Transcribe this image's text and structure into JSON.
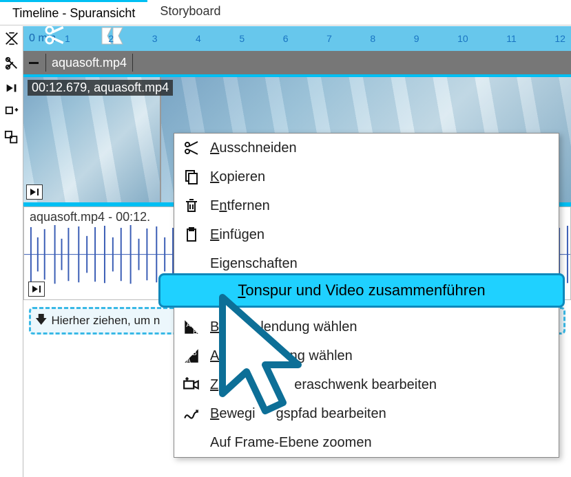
{
  "tabs": {
    "timeline": "Timeline - Spuransicht",
    "storyboard": "Storyboard"
  },
  "ruler": {
    "firstlabel": "0 min",
    "ticks": [
      "1",
      "2",
      "3",
      "4",
      "5",
      "6",
      "7",
      "8",
      "9",
      "10",
      "11",
      "12"
    ]
  },
  "trackheader": {
    "filename": "aquasoft.mp4"
  },
  "video": {
    "label": "00:12.679,  aquasoft.mp4"
  },
  "audio": {
    "label": "aquasoft.mp4 - 00:12."
  },
  "droprow": {
    "text": "Hierher ziehen, um n"
  },
  "menu": {
    "cut": "Ausschneiden",
    "copy": "Kopieren",
    "remove": "Entfernen",
    "paste": "Einfügen",
    "props": "Eigenschaften",
    "merge": "Tonspur und Video zusammenführen",
    "fadein_pre": "B",
    "fadein_rest": "lendung wählen",
    "fadeout_pre": "A",
    "fadeout_rest": "dung wählen",
    "camera_pre": "Z",
    "camera_rest": "eraschwenk bearbeiten",
    "path_pre": "B",
    "path_visible": "ewegi",
    "path_rest": "gspfad bearbeiten",
    "zoom": "Auf Frame-Ebene zoomen"
  }
}
